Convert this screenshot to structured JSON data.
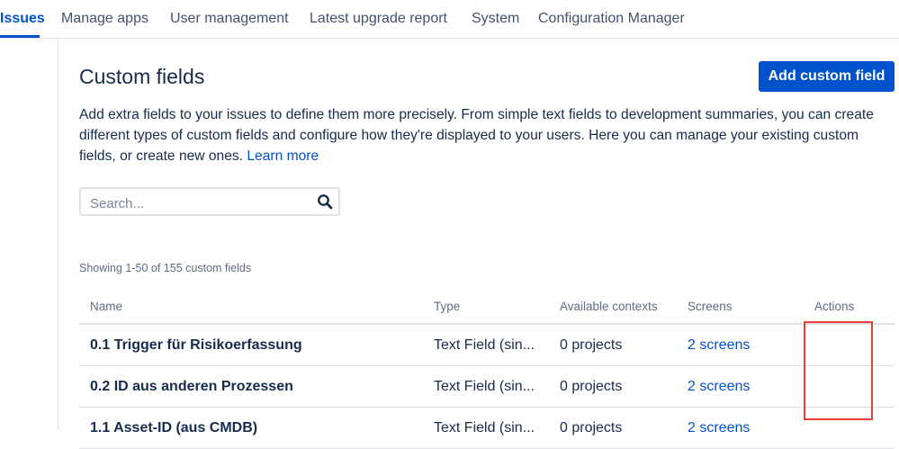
{
  "nav": {
    "tabs": [
      {
        "label": "Issues",
        "active": true
      },
      {
        "label": "Manage apps"
      },
      {
        "label": "User management"
      },
      {
        "label": "Latest upgrade report"
      },
      {
        "label": "System"
      },
      {
        "label": "Configuration Manager"
      }
    ]
  },
  "page": {
    "title": "Custom fields",
    "add_button": "Add custom field",
    "description": "Add extra fields to your issues to define them more precisely. From simple text fields to development summaries, you can create different types of custom fields and configure how they're displayed to your users. Here you can manage your existing custom fields, or create new ones.",
    "learn_more": "Learn more"
  },
  "search": {
    "placeholder": "Search...",
    "value": "",
    "icon": "search-icon"
  },
  "table": {
    "summary": "Showing 1-50 of 155 custom fields",
    "headers": {
      "name": "Name",
      "type": "Type",
      "contexts": "Available contexts",
      "screens": "Screens",
      "actions": "Actions"
    },
    "rows": [
      {
        "name": "0.1 Trigger für Risikoerfassung",
        "type": "Text Field (sin...",
        "contexts": "0 projects",
        "screens": "2 screens"
      },
      {
        "name": "0.2 ID aus anderen Prozessen",
        "type": "Text Field (sin...",
        "contexts": "0 projects",
        "screens": "2 screens"
      },
      {
        "name": "1.1 Asset-ID (aus CMDB)",
        "type": "Text Field (sin...",
        "contexts": "0 projects",
        "screens": "2 screens"
      }
    ]
  },
  "colors": {
    "accent": "#0052cc",
    "highlight": "#e5403a",
    "text": "#172b4d",
    "muted": "#5e6c84"
  }
}
